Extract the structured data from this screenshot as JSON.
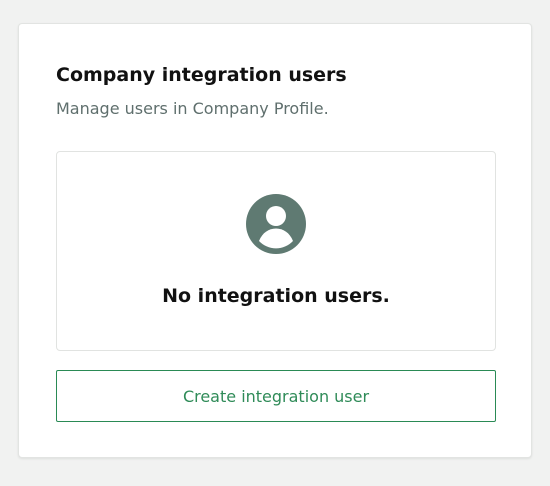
{
  "colors": {
    "page_background": "#f1f2f1",
    "card_background": "#ffffff",
    "title": "#111111",
    "subtitle": "#5f6f6d",
    "avatar_icon": "#5f7a72",
    "button_border": "#2a8a55",
    "button_text": "#2f8b58"
  },
  "card": {
    "title": "Company integration users",
    "subtitle": "Manage users in Company Profile.",
    "empty_state": {
      "icon": "user-circle-icon",
      "message": "No integration users."
    },
    "create_button_label": "Create integration user"
  }
}
